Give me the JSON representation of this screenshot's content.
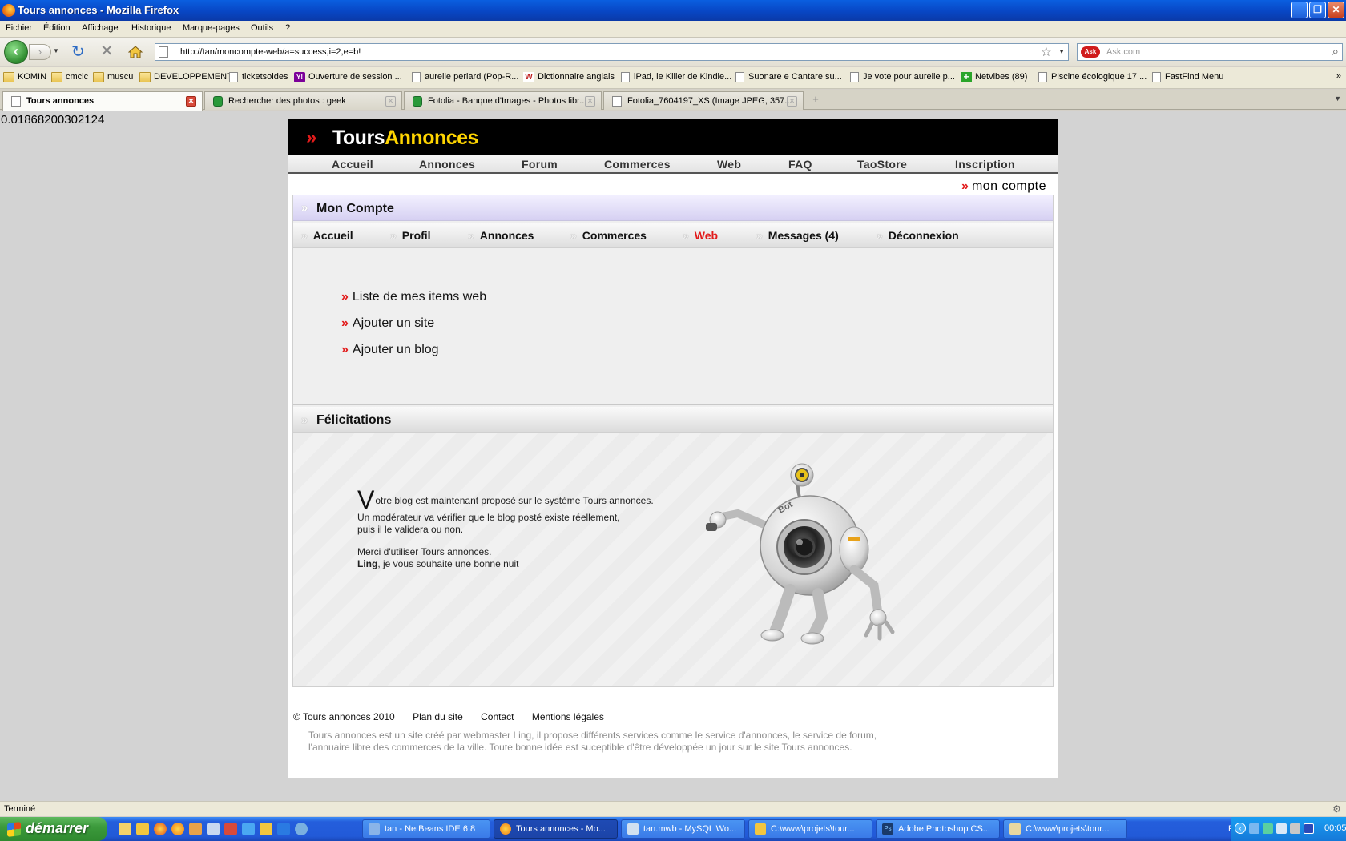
{
  "window": {
    "title": "Tours annonces - Mozilla Firefox"
  },
  "menu": [
    "Fichier",
    "Édition",
    "Affichage",
    "Historique",
    "Marque-pages",
    "Outils",
    "?"
  ],
  "nav": {
    "url": "http://tan/moncompte-web/a=success,i=2,e=b!",
    "search_placeholder": "Ask.com"
  },
  "bookmarks": [
    {
      "label": "KOMIN",
      "icon": "folder"
    },
    {
      "label": "cmcic",
      "icon": "folder"
    },
    {
      "label": "muscu",
      "icon": "folder"
    },
    {
      "label": "DEVELOPPEMENT",
      "icon": "folder"
    },
    {
      "label": "ticketsoldes",
      "icon": "page"
    },
    {
      "label": "Ouverture de session ...",
      "icon": "yahoo"
    },
    {
      "label": "aurelie periard (Pop-R...",
      "icon": "page"
    },
    {
      "label": "Dictionnaire anglais",
      "icon": "wr"
    },
    {
      "label": "iPad, le Killer de Kindle...",
      "icon": "page"
    },
    {
      "label": "Suonare e Cantare su...",
      "icon": "page"
    },
    {
      "label": "Je vote pour aurelie p...",
      "icon": "page"
    },
    {
      "label": "Netvibes (89)",
      "icon": "plus"
    },
    {
      "label": "Piscine écologique 17 ...",
      "icon": "page"
    },
    {
      "label": "FastFind Menu",
      "icon": "page"
    }
  ],
  "bookmarks_more": "»",
  "tabs": [
    {
      "label": "Tours annonces",
      "active": true
    },
    {
      "label": "Rechercher des photos : geek",
      "active": false
    },
    {
      "label": "Fotolia - Banque d'Images - Photos libr...",
      "active": false
    },
    {
      "label": "Fotolia_7604197_XS (Image JPEG, 357...",
      "active": false
    }
  ],
  "page": {
    "debug_value": "0.01868200302124",
    "logo": {
      "part1": "Tours",
      "part2": "Annonces"
    },
    "main_nav": [
      "Accueil",
      "Annonces",
      "Forum",
      "Commerces",
      "Web",
      "FAQ",
      "TaoStore",
      "Inscription"
    ],
    "account_link": "mon compte",
    "panel_title": "Mon Compte",
    "sub_nav": [
      {
        "label": "Accueil",
        "active": false
      },
      {
        "label": "Profil",
        "active": false
      },
      {
        "label": "Annonces",
        "active": false
      },
      {
        "label": "Commerces",
        "active": false
      },
      {
        "label": "Web",
        "active": true
      },
      {
        "label": "Messages (4)",
        "active": false
      },
      {
        "label": "Déconnexion",
        "active": false
      }
    ],
    "web_links": [
      "Liste de mes items web",
      "Ajouter un site",
      "Ajouter un blog"
    ],
    "congrats_title": "Félicitations",
    "message": {
      "first_letter": "V",
      "line1_rest": "otre blog est maintenant proposé sur le système Tours annonces.",
      "line2": "Un modérateur va vérifier que le blog posté existe réellement,",
      "line3": "puis il le validera ou non.",
      "line4": "Merci d'utiliser Tours annonces.",
      "signature_name": "Ling",
      "signature_rest": ", je vous souhaite une bonne nuit"
    },
    "robot_text": "Bot",
    "footer": {
      "copyright": "© Tours annonces 2010",
      "links": [
        "Plan du site",
        "Contact",
        "Mentions légales"
      ],
      "about_line1": "Tours annonces est un site créé par webmaster Ling, il propose différents services comme le service d'annonces, le service de forum,",
      "about_line2": "l'annuaire libre des commerces de la ville. Toute bonne idée est suceptible d'être développée un jour sur le site Tours annonces."
    }
  },
  "status": "Terminé",
  "taskbar": {
    "start": "démarrer",
    "buttons": [
      {
        "label": "tan - NetBeans IDE 6.8",
        "active": false
      },
      {
        "label": "Tours annonces - Mo...",
        "active": true
      },
      {
        "label": "tan.mwb - MySQL Wo...",
        "active": false
      },
      {
        "label": "C:\\www\\projets\\tour...",
        "active": false
      },
      {
        "label": "Adobe Photoshop CS...",
        "active": false
      },
      {
        "label": "C:\\www\\projets\\tour...",
        "active": false
      }
    ],
    "lang": "FR",
    "clock": "00:05"
  },
  "colors": {
    "accent_red": "#e21b1b",
    "logo_yellow": "#ffd500",
    "xp_blue": "#245edc"
  }
}
